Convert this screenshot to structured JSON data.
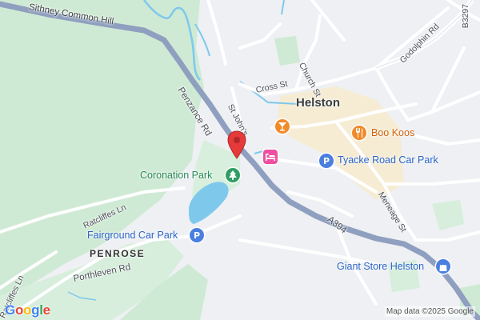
{
  "map": {
    "town_label": "Helston",
    "area_label": "PENROSE",
    "roads": {
      "sithney_common_hill": "Sithney Common Hill",
      "penzance_rd": "Penzance Rd",
      "st_johns": "St John's",
      "cross_st": "Cross St",
      "church_st": "Church St",
      "godolphin_rd": "Godolphin Rd",
      "b3297": "B3297",
      "a394": "A394",
      "meneage_st": "Meneage St",
      "ratcliffes_ln_1": "Ratcliffes Ln",
      "ratcliffes_ln_2": "Ratcliffes Ln",
      "porthleven_rd": "Porthleven Rd"
    },
    "places": {
      "coronation_park": "Coronation Park",
      "fairground_car_park": "Fairground Car Park",
      "tyacke_road_car_park": "Tyacke Road Car Park",
      "boo_koos": "Boo Koos",
      "giant_store_helston": "Giant Store Helston"
    },
    "icons": {
      "parking_glyph": "P",
      "food_icon": "fork-knife-icon",
      "bar_icon": "cocktail-icon",
      "hotel_icon": "bed-icon",
      "park_icon": "tree-icon",
      "shop_icon": "shopping-bag-icon",
      "pin_icon": "location-pin-icon"
    },
    "colors": {
      "pin": "#e5393a",
      "parking": "#4a7fe0",
      "food": "#f18a2b",
      "hotel": "#ee4fa0",
      "park": "#2e9e63",
      "shop": "#4a7fe0",
      "road_main": "#8f9fbf",
      "water": "#7ec8ec",
      "green": "#cfead4"
    },
    "logo": {
      "g1": "G",
      "o1": "o",
      "o2": "o",
      "g2": "g",
      "l": "l",
      "e": "e"
    },
    "attribution": "Map data ©2025 Google"
  }
}
